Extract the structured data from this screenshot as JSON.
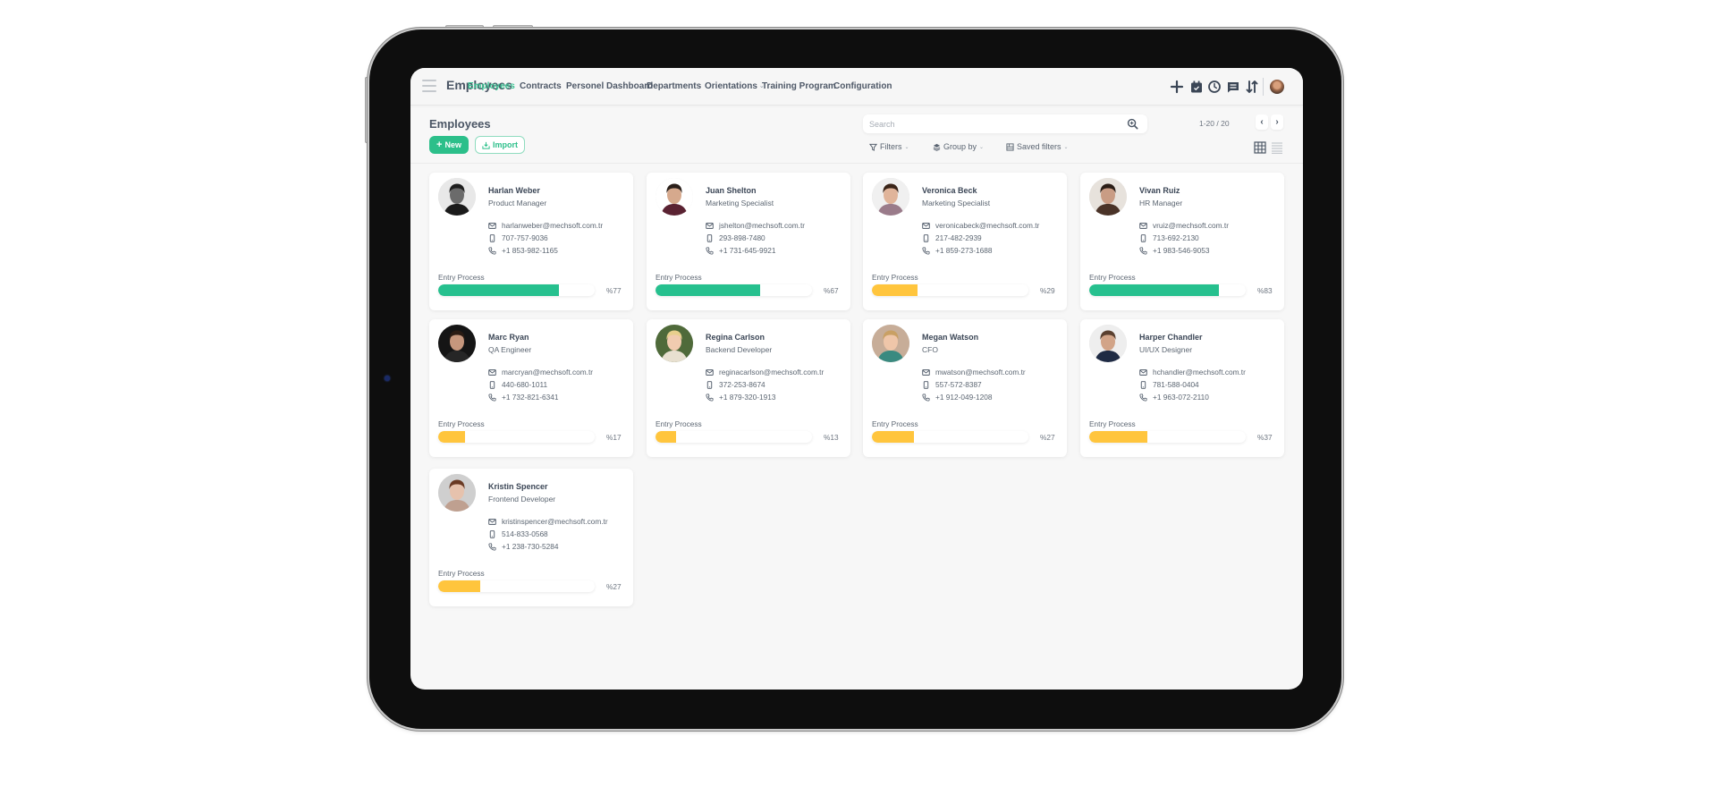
{
  "app": {
    "title": "Employees"
  },
  "nav": [
    {
      "label": "Employees",
      "active": true,
      "dropdown": false
    },
    {
      "label": "Contracts",
      "active": false,
      "dropdown": false
    },
    {
      "label": "Personel Dashboard",
      "active": false,
      "dropdown": false
    },
    {
      "label": "Departments",
      "active": false,
      "dropdown": false
    },
    {
      "label": "Orientations",
      "active": false,
      "dropdown": true
    },
    {
      "label": "Training Program",
      "active": false,
      "dropdown": false
    },
    {
      "label": "Configuration",
      "active": false,
      "dropdown": false
    }
  ],
  "header_icons": [
    "plus-icon",
    "calendar-check-icon",
    "clock-icon",
    "chat-icon",
    "sort-icon",
    "user-avatar"
  ],
  "page": {
    "title": "Employees",
    "new_label": "New",
    "import_label": "Import",
    "search_placeholder": "Search",
    "search_value": "",
    "pager": "1-20 / 20",
    "filters_label": "Filters",
    "groupby_label": "Group by",
    "saved_filters_label": "Saved filters",
    "view_mode": "kanban"
  },
  "colors": {
    "accent": "#2cbf8a",
    "progress_high": "#26c08e",
    "progress_low": "#ffc53d",
    "nav_active": "#3cc394"
  },
  "progress_label": "Entry Process",
  "employees": [
    {
      "name": "Harlan Weber",
      "role": "Product Manager",
      "email": "harlanweber@mechsoft.com.tr",
      "mobile": "707-757-9036",
      "phone": "+1 853-982-1165",
      "progress": 77,
      "progress_text": "%77",
      "status": "high"
    },
    {
      "name": "Juan Shelton",
      "role": "Marketing Specialist",
      "email": "jshelton@mechsoft.com.tr",
      "mobile": "293-898-7480",
      "phone": "+1 731-645-9921",
      "progress": 67,
      "progress_text": "%67",
      "status": "high"
    },
    {
      "name": "Veronica Beck",
      "role": "Marketing Specialist",
      "email": "veronicabeck@mechsoft.com.tr",
      "mobile": "217-482-2939",
      "phone": "+1 859-273-1688",
      "progress": 29,
      "progress_text": "%29",
      "status": "low"
    },
    {
      "name": "Vivan Ruiz",
      "role": "HR Manager",
      "email": "vruiz@mechsoft.com.tr",
      "mobile": "713-692-2130",
      "phone": "+1 983-546-9053",
      "progress": 83,
      "progress_text": "%83",
      "status": "high"
    },
    {
      "name": "Marc Ryan",
      "role": "QA Engineer",
      "email": "marcryan@mechsoft.com.tr",
      "mobile": "440-680-1011",
      "phone": "+1 732-821-6341",
      "progress": 17,
      "progress_text": "%17",
      "status": "low"
    },
    {
      "name": "Regina Carlson",
      "role": "Backend Developer",
      "email": "reginacarlson@mechsoft.com.tr",
      "mobile": "372-253-8674",
      "phone": "+1 879-320-1913",
      "progress": 13,
      "progress_text": "%13",
      "status": "low"
    },
    {
      "name": "Megan Watson",
      "role": "CFO",
      "email": "mwatson@mechsoft.com.tr",
      "mobile": "557-572-8387",
      "phone": "+1 912-049-1208",
      "progress": 27,
      "progress_text": "%27",
      "status": "low"
    },
    {
      "name": "Harper Chandler",
      "role": "UI/UX Designer",
      "email": "hchandler@mechsoft.com.tr",
      "mobile": "781-588-0404",
      "phone": "+1 963-072-2110",
      "progress": 37,
      "progress_text": "%37",
      "status": "low"
    },
    {
      "name": "Kristin Spencer",
      "role": "Frontend Developer",
      "email": "kristinspencer@mechsoft.com.tr",
      "mobile": "514-833-0568",
      "phone": "+1 238-730-5284",
      "progress": 27,
      "progress_text": "%27",
      "status": "low"
    }
  ]
}
